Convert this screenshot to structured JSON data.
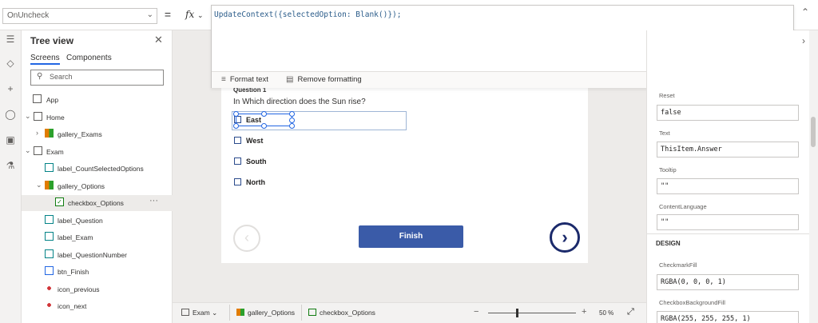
{
  "formula_bar": {
    "property": "OnUncheck",
    "equals": "=",
    "fx": "fx",
    "formula": "UpdateContext({selectedOption: Blank()});",
    "format_text": "Format text",
    "remove_formatting": "Remove formatting"
  },
  "tree": {
    "title": "Tree view",
    "tabs": [
      "Screens",
      "Components"
    ],
    "search_placeholder": "Search",
    "nodes": [
      {
        "label": "App"
      },
      {
        "label": "Home"
      },
      {
        "label": "gallery_Exams"
      },
      {
        "label": "Exam"
      },
      {
        "label": "label_CountSelectedOptions"
      },
      {
        "label": "gallery_Options"
      },
      {
        "label": "checkbox_Options"
      },
      {
        "label": "label_Question"
      },
      {
        "label": "label_Exam"
      },
      {
        "label": "label_QuestionNumber"
      },
      {
        "label": "btn_Finish"
      },
      {
        "label": "icon_previous"
      },
      {
        "label": "icon_next"
      }
    ],
    "more": "···"
  },
  "canvas": {
    "question_title": "Question 1",
    "question_text": "In Which direction does the Sun rise?",
    "options": [
      "East",
      "West",
      "South",
      "North"
    ],
    "finish_label": "Finish"
  },
  "properties": {
    "fields": [
      {
        "label": "Reset",
        "value": "false"
      },
      {
        "label": "Text",
        "value": "ThisItem.Answer"
      },
      {
        "label": "Tooltip",
        "value": "\"\""
      },
      {
        "label": "ContentLanguage",
        "value": "\"\""
      }
    ],
    "design_header": "DESIGN",
    "design_fields": [
      {
        "label": "CheckmarkFill",
        "value": "RGBA(0, 0, 0, 1)"
      },
      {
        "label": "CheckboxBackgroundFill",
        "value": "RGBA(255, 255, 255, 1)"
      }
    ]
  },
  "status": {
    "crumbs": [
      "Exam",
      "gallery_Options",
      "checkbox_Options"
    ],
    "zoom": "50 %",
    "zoom_level": 0.33
  },
  "colors": {
    "accent": "#2266e3",
    "finish_button": "#3a5ba8",
    "next_icon": "#1b2a6b"
  }
}
